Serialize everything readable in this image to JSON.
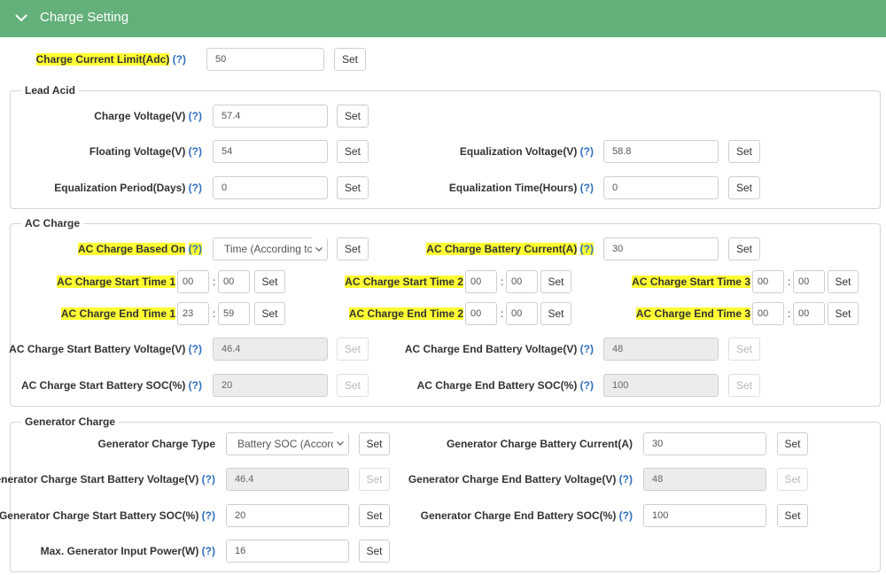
{
  "header": {
    "title": "Charge Setting",
    "accent": "#63b07a"
  },
  "help_mark": "(?)",
  "time_colon": ":",
  "top": {
    "label": "Charge Current Limit(Adc)",
    "value": "50",
    "set": "Set"
  },
  "lead_acid": {
    "legend": "Lead Acid",
    "charge_voltage": {
      "label": "Charge Voltage(V)",
      "value": "57.4",
      "set": "Set"
    },
    "floating_voltage": {
      "label": "Floating Voltage(V)",
      "value": "54",
      "set": "Set"
    },
    "equalization_voltage": {
      "label": "Equalization Voltage(V)",
      "value": "58.8",
      "set": "Set"
    },
    "equalization_period": {
      "label": "Equalization Period(Days)",
      "value": "0",
      "set": "Set"
    },
    "equalization_time": {
      "label": "Equalization Time(Hours)",
      "value": "0",
      "set": "Set"
    }
  },
  "ac_charge": {
    "legend": "AC Charge",
    "based_on": {
      "label": "AC Charge Based On",
      "selected": "Time (According tc",
      "set": "Set"
    },
    "battery_current": {
      "label": "AC Charge Battery Current(A)",
      "value": "30",
      "set": "Set"
    },
    "start_time_1": {
      "label": "AC Charge Start Time 1",
      "hour": "00",
      "minute": "00",
      "set": "Set"
    },
    "start_time_2": {
      "label": "AC Charge Start Time 2",
      "hour": "00",
      "minute": "00",
      "set": "Set"
    },
    "start_time_3": {
      "label": "AC Charge Start Time 3",
      "hour": "00",
      "minute": "00",
      "set": "Set"
    },
    "end_time_1": {
      "label": "AC Charge End Time 1",
      "hour": "23",
      "minute": "59",
      "set": "Set"
    },
    "end_time_2": {
      "label": "AC Charge End Time 2",
      "hour": "00",
      "minute": "00",
      "set": "Set"
    },
    "end_time_3": {
      "label": "AC Charge End Time 3",
      "hour": "00",
      "minute": "00",
      "set": "Set"
    },
    "start_battery_voltage": {
      "label": "AC Charge Start Battery Voltage(V)",
      "value": "46.4",
      "set": "Set"
    },
    "end_battery_voltage": {
      "label": "AC Charge End Battery Voltage(V)",
      "value": "48",
      "set": "Set"
    },
    "start_battery_soc": {
      "label": "AC Charge Start Battery SOC(%)",
      "value": "20",
      "set": "Set"
    },
    "end_battery_soc": {
      "label": "AC Charge End Battery SOC(%)",
      "value": "100",
      "set": "Set"
    }
  },
  "generator": {
    "legend": "Generator Charge",
    "charge_type": {
      "label": "Generator Charge Type",
      "selected": "Battery SOC (Accord",
      "set": "Set"
    },
    "battery_current": {
      "label": "Generator Charge Battery Current(A)",
      "value": "30",
      "set": "Set"
    },
    "start_battery_voltage": {
      "label": "Generator Charge Start Battery Voltage(V)",
      "value": "46.4",
      "set": "Set"
    },
    "end_battery_voltage": {
      "label": "Generator Charge End Battery Voltage(V)",
      "value": "48",
      "set": "Set"
    },
    "start_battery_soc": {
      "label": "Generator Charge Start Battery SOC(%)",
      "value": "20",
      "set": "Set"
    },
    "end_battery_soc": {
      "label": "Generator Charge End Battery SOC(%)",
      "value": "100",
      "set": "Set"
    },
    "max_input_power": {
      "label": "Max. Generator Input Power(W)",
      "value": "16",
      "set": "Set"
    }
  },
  "icons": {
    "collapse": "chevron-down-icon",
    "help": "help-icon",
    "dropdown": "dropdown-arrow-icon"
  },
  "colors": {
    "highlight": "#ffff33",
    "help_link": "#2f6fbf",
    "disabled_field": "#ececec"
  }
}
